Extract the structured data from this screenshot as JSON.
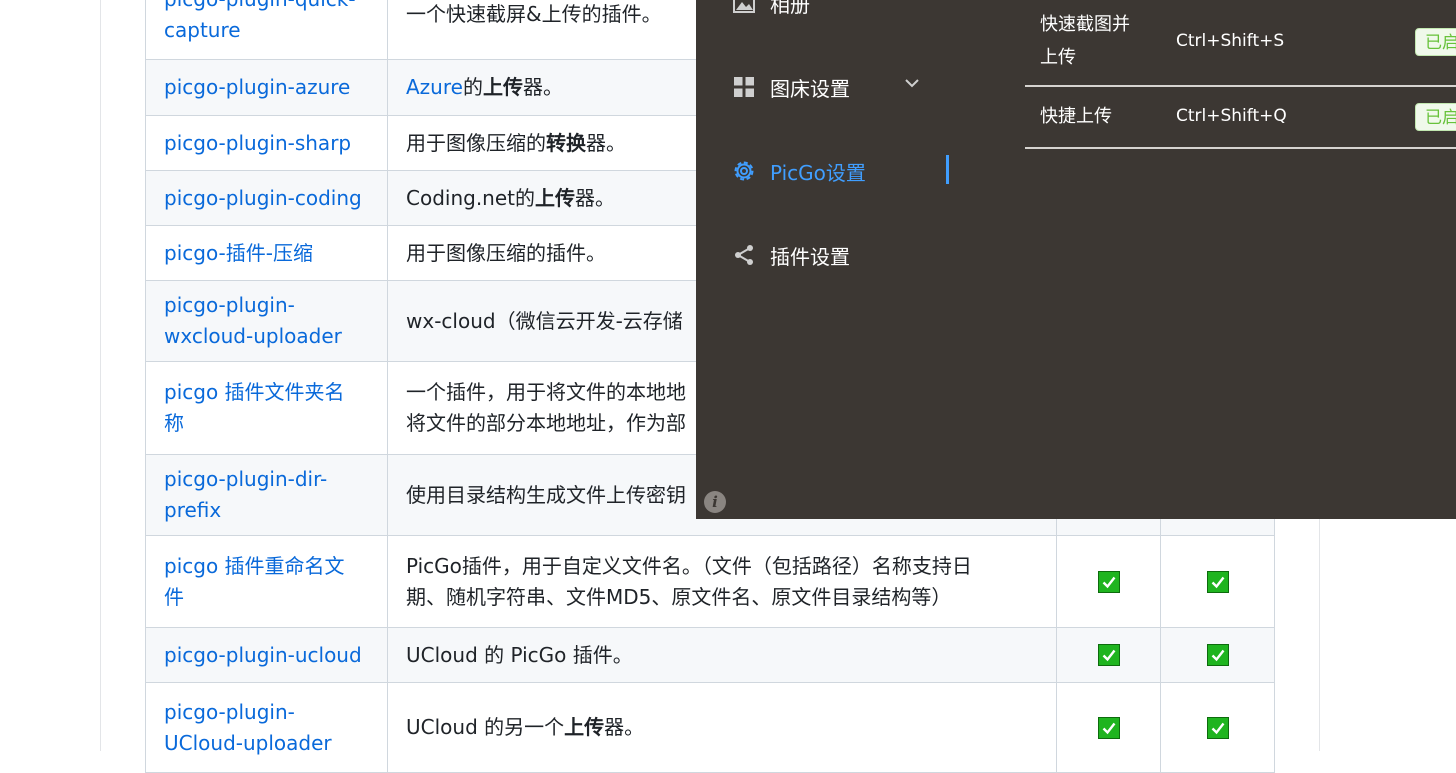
{
  "plugins": [
    {
      "name": "picgo-plugin-quick-\ncapture",
      "desc_parts": [
        {
          "t": "一个快速截屏&上传的插件。"
        }
      ],
      "c1": false,
      "c2": false
    },
    {
      "name": "picgo-plugin-azure",
      "desc_parts": [
        {
          "t": "Azure",
          "link": true
        },
        {
          "t": "的"
        },
        {
          "t": "上传",
          "b": true
        },
        {
          "t": "器。"
        }
      ],
      "c1": false,
      "c2": false
    },
    {
      "name": "picgo-plugin-sharp",
      "desc_parts": [
        {
          "t": "用于图像压缩的"
        },
        {
          "t": "转换",
          "b": true
        },
        {
          "t": "器。"
        }
      ],
      "c1": false,
      "c2": false
    },
    {
      "name": "picgo-plugin-coding",
      "desc_parts": [
        {
          "t": "Coding.net的"
        },
        {
          "t": "上传",
          "b": true
        },
        {
          "t": "器。"
        }
      ],
      "c1": false,
      "c2": false
    },
    {
      "name": "picgo-插件-压缩",
      "desc_parts": [
        {
          "t": "用于图像压缩的插件。"
        }
      ],
      "c1": false,
      "c2": false
    },
    {
      "name": "picgo-plugin-\nwxcloud-uploader",
      "desc_parts": [
        {
          "t": "wx-cloud（微信云开发-云存储"
        }
      ],
      "c1": false,
      "c2": false
    },
    {
      "name": "picgo 插件文件夹名\n称",
      "desc_parts": [
        {
          "t": "一个插件，用于将文件的本地地\n将文件的部分本地地址，作为部"
        }
      ],
      "c1": false,
      "c2": false
    },
    {
      "name": "picgo-plugin-dir-\nprefix",
      "desc_parts": [
        {
          "t": "使用目录结构生成文件上传密钥"
        }
      ],
      "c1": false,
      "c2": false
    },
    {
      "name": "picgo 插件重命名文\n件",
      "desc_parts": [
        {
          "t": "PicGo插件，用于自定义文件名。（文件（包括路径）名称支持日\n期、随机字符串、文件MD5、原文件名、原文件目录结构等）"
        }
      ],
      "c1": true,
      "c2": true
    },
    {
      "name": "picgo-plugin-ucloud",
      "desc_parts": [
        {
          "t": "UCloud 的 PicGo 插件。"
        }
      ],
      "c1": true,
      "c2": true
    },
    {
      "name": "picgo-plugin-\nUCloud-uploader",
      "desc_parts": [
        {
          "t": "UCloud 的另一个"
        },
        {
          "t": "上传",
          "b": true
        },
        {
          "t": "器。"
        }
      ],
      "c1": true,
      "c2": true
    }
  ],
  "app": {
    "nav": {
      "album": "相册",
      "bed_settings": "图床设置",
      "picgo_settings": "PicGo设置",
      "plugin_settings": "插件设置"
    },
    "shortcuts": [
      {
        "name": "快速截图并\n上传",
        "key": "Ctrl+Shift+S",
        "status": "已启"
      },
      {
        "name": "快捷上传",
        "key": "Ctrl+Shift+Q",
        "status": "已启"
      }
    ],
    "colors": {
      "bg": "#3c3733",
      "accent": "#409eff",
      "check": "#1fb41f"
    }
  }
}
